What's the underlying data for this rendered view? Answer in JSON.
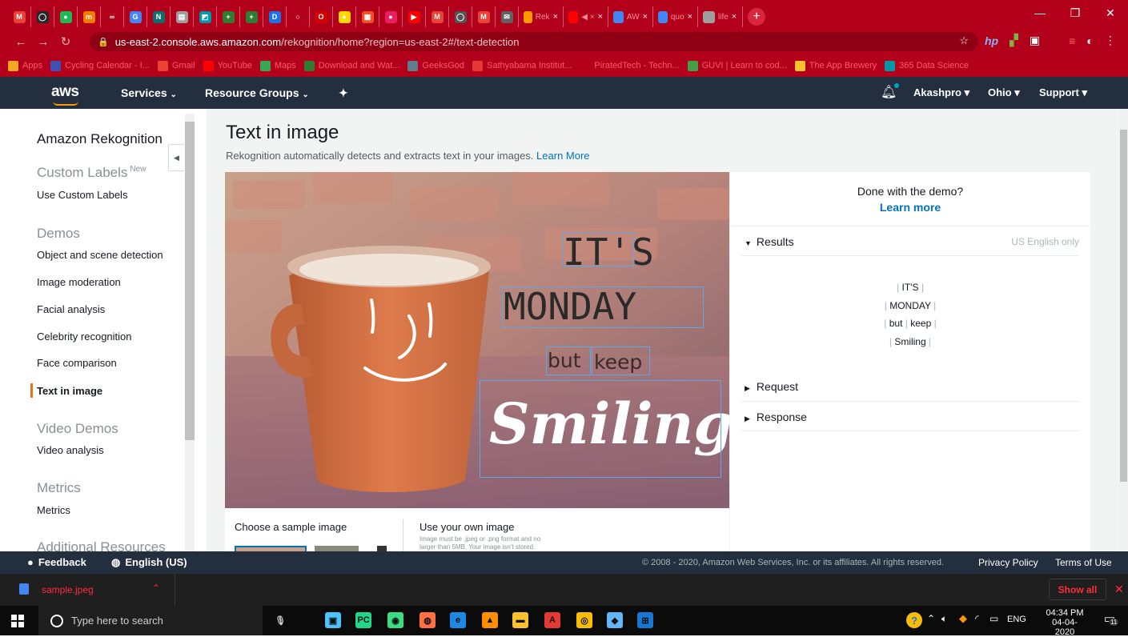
{
  "browser": {
    "tabs": [
      {
        "icon": "gmail-icon",
        "color": "#ea4335",
        "label": "",
        "glyph": "M"
      },
      {
        "icon": "github-icon",
        "color": "#24292e",
        "label": "",
        "glyph": "◯"
      },
      {
        "icon": "green-circle-icon",
        "color": "#1db954",
        "label": "",
        "glyph": "●"
      },
      {
        "icon": "orange-square-icon",
        "color": "#f57c00",
        "label": "",
        "glyph": "m"
      },
      {
        "icon": "infinity-icon",
        "color": "#b3001b",
        "label": "",
        "glyph": "∞"
      },
      {
        "icon": "google-icon",
        "color": "#4285f4",
        "label": "",
        "glyph": "G"
      },
      {
        "icon": "n-icon",
        "color": "#0d6e6e",
        "label": "",
        "glyph": "N"
      },
      {
        "icon": "doc-icon",
        "color": "#9e9e9e",
        "label": "",
        "glyph": "▤"
      },
      {
        "icon": "teal-chart-icon",
        "color": "#0097a7",
        "label": "",
        "glyph": "◩"
      },
      {
        "icon": "green-plus-icon",
        "color": "#2e7d32",
        "label": "",
        "glyph": "+"
      },
      {
        "icon": "green-plus-icon",
        "color": "#2e7d32",
        "label": "",
        "glyph": "+"
      },
      {
        "icon": "blue-d-icon",
        "color": "#1a73e8",
        "label": "",
        "glyph": "D"
      },
      {
        "icon": "ring-icon",
        "color": "#b3001b",
        "label": "",
        "glyph": "○"
      },
      {
        "icon": "opera-icon",
        "color": "#d50000",
        "label": "",
        "glyph": "O"
      },
      {
        "icon": "yellow-circle-icon",
        "color": "#ffd600",
        "label": "",
        "glyph": "●"
      },
      {
        "icon": "microsoft-icon",
        "color": "#f25022",
        "label": "",
        "glyph": "▦"
      },
      {
        "icon": "pink-circle-icon",
        "color": "#e91e63",
        "label": "",
        "glyph": "●"
      },
      {
        "icon": "youtube-icon",
        "color": "#ff0000",
        "label": "",
        "glyph": "▶"
      },
      {
        "icon": "gmail-icon",
        "color": "#ea4335",
        "label": "",
        "glyph": "M"
      },
      {
        "icon": "github-icon",
        "color": "#555555",
        "label": "",
        "glyph": "◯"
      },
      {
        "icon": "gmail-icon",
        "color": "#ea4335",
        "label": "",
        "glyph": "M"
      },
      {
        "icon": "mail-icon",
        "color": "#616161",
        "label": "",
        "glyph": "✉"
      }
    ],
    "labeled_tabs": [
      {
        "icon": "aws-box-icon",
        "color": "#ff9900",
        "label": "Rek"
      },
      {
        "icon": "youtube-icon",
        "color": "#ff0000",
        "label": "◀ ×"
      },
      {
        "icon": "doc-blue-icon",
        "color": "#4285f4",
        "label": "AW"
      },
      {
        "icon": "google-icon",
        "color": "#4285f4",
        "label": "quo"
      },
      {
        "icon": "wiki-icon",
        "color": "#9e9e9e",
        "label": "life"
      }
    ],
    "url_host": "us-east-2.console.aws.amazon.com",
    "url_path": "/rekognition/home?region=us-east-2#/text-detection",
    "bookmarks": [
      {
        "label": "Apps",
        "icon": "apps-grid-icon",
        "color": "#f5a623"
      },
      {
        "label": "Cycling Calendar - I...",
        "icon": "cycling-icon",
        "color": "#3f51b5"
      },
      {
        "label": "Gmail",
        "icon": "gmail-icon",
        "color": "#ea4335"
      },
      {
        "label": "YouTube",
        "icon": "youtube-icon",
        "color": "#ff0000"
      },
      {
        "label": "Maps",
        "icon": "maps-icon",
        "color": "#34a853"
      },
      {
        "label": "Download and Wat...",
        "icon": "tr-icon",
        "color": "#2e7d32"
      },
      {
        "label": "GeeksGod",
        "icon": "geeks-icon",
        "color": "#607d8b"
      },
      {
        "label": "Sathyabama Institut...",
        "icon": "sathyabama-icon",
        "color": "#e53935"
      },
      {
        "label": "PiratedTech - Techn...",
        "icon": "pirated-icon",
        "color": "#b3001b"
      },
      {
        "label": "GUVI | Learn to cod...",
        "icon": "guvi-icon",
        "color": "#43a047"
      },
      {
        "label": "The App Brewery",
        "icon": "app-brewery-icon",
        "color": "#fbc02d"
      },
      {
        "label": "365 Data Science",
        "icon": "data-science-icon",
        "color": "#0097a7"
      }
    ]
  },
  "aws_nav": {
    "logo": "aws",
    "services": "Services",
    "resource_groups": "Resource Groups",
    "user": "Akashpro",
    "region": "Ohio",
    "support": "Support"
  },
  "sidebar": {
    "title": "Amazon Rekognition",
    "custom_labels_header": "Custom Labels",
    "new_badge": "New",
    "use_custom_labels": "Use Custom Labels",
    "demos_header": "Demos",
    "demos": [
      "Object and scene detection",
      "Image moderation",
      "Facial analysis",
      "Celebrity recognition",
      "Face comparison",
      "Text in image"
    ],
    "video_demos_header": "Video Demos",
    "video_analysis": "Video analysis",
    "metrics_header": "Metrics",
    "metrics": "Metrics",
    "additional_header": "Additional Resources"
  },
  "main": {
    "title": "Text in image",
    "subtitle": "Rekognition automatically detects and extracts text in your images.",
    "learn_more": "Learn More",
    "image_words": {
      "its": "IT'S",
      "monday": "MONDAY",
      "but": "but",
      "keep": "keep",
      "smiling": "Smiling"
    },
    "choose_sample": "Choose a sample image",
    "use_own": "Use your own image",
    "own_note_1": "Image must be .jpeg or .png format and no",
    "own_note_2": "larger than 5MB. Your image isn't stored."
  },
  "results_panel": {
    "done_demo": "Done with the demo?",
    "learn_more": "Learn more",
    "results": "Results",
    "language_note": "US English only",
    "lines": [
      [
        "IT'S"
      ],
      [
        "MONDAY"
      ],
      [
        "but",
        "keep"
      ],
      [
        "Smiling"
      ]
    ],
    "request": "Request",
    "response": "Response"
  },
  "footer": {
    "feedback": "Feedback",
    "language": "English (US)",
    "copyright": "© 2008 - 2020, Amazon Web Services, Inc. or its affiliates. All rights reserved.",
    "privacy": "Privacy Policy",
    "terms": "Terms of Use"
  },
  "downloads": {
    "file": "sample.jpeg",
    "show_all": "Show all"
  },
  "taskbar": {
    "search_placeholder": "Type here to search",
    "language": "ENG",
    "time": "04:34 PM",
    "date": "04-04-2020",
    "notifications": "11",
    "apps": [
      {
        "icon": "mic-icon",
        "color": "#cccccc",
        "glyph": "🎙"
      },
      {
        "icon": "paint-icon",
        "color": "#4fc3f7",
        "glyph": "▣"
      },
      {
        "icon": "pycharm-icon",
        "color": "#21d789",
        "glyph": "PC"
      },
      {
        "icon": "android-icon",
        "color": "#3ddc84",
        "glyph": "◉"
      },
      {
        "icon": "recorder-icon",
        "color": "#ff7043",
        "glyph": "◍"
      },
      {
        "icon": "edge-icon",
        "color": "#1e88e5",
        "glyph": "e"
      },
      {
        "icon": "vlc-icon",
        "color": "#ff8f00",
        "glyph": "▲"
      },
      {
        "icon": "folder-icon",
        "color": "#fbc02d",
        "glyph": "▬"
      },
      {
        "icon": "acrobat-icon",
        "color": "#e53935",
        "glyph": "A"
      },
      {
        "icon": "chrome-icon",
        "color": "#fbbc05",
        "glyph": "◎"
      },
      {
        "icon": "vscode-icon",
        "color": "#64b5f6",
        "glyph": "◆"
      },
      {
        "icon": "network-icon",
        "color": "#1976d2",
        "glyph": "⊞"
      }
    ]
  },
  "colors": {
    "browser_theme": "#b3001b",
    "aws_nav": "#232f3e",
    "aws_orange": "#ff9900",
    "link": "#0073bb",
    "bbox": "#5fa8e8"
  }
}
